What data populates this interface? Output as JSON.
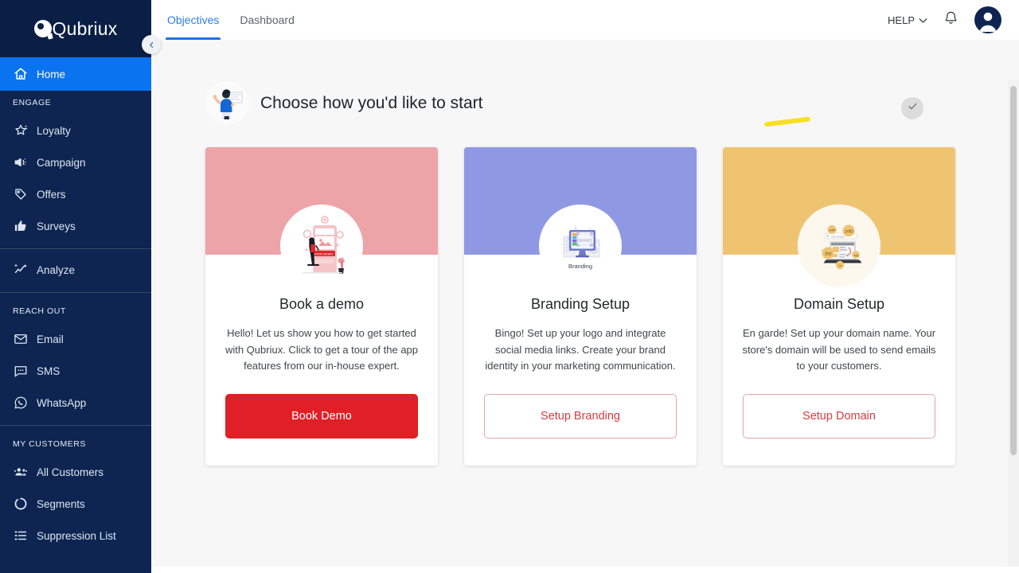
{
  "brand": {
    "name": "Qubriux"
  },
  "sidebar": {
    "collapse_icon": "chevron-left-icon",
    "home": {
      "label": "Home",
      "icon": "home-icon"
    },
    "groups": [
      {
        "label": "ENGAGE",
        "items": [
          {
            "label": "Loyalty",
            "icon": "star-badge-icon"
          },
          {
            "label": "Campaign",
            "icon": "megaphone-icon"
          },
          {
            "label": "Offers",
            "icon": "tag-icon"
          },
          {
            "label": "Surveys",
            "icon": "thumbs-up-icon"
          },
          {
            "label": "Analyze",
            "icon": "analytics-icon"
          }
        ]
      },
      {
        "label": "REACH OUT",
        "items": [
          {
            "label": "Email",
            "icon": "envelope-icon"
          },
          {
            "label": "SMS",
            "icon": "chat-bubble-icon"
          },
          {
            "label": "WhatsApp",
            "icon": "whatsapp-icon"
          }
        ]
      },
      {
        "label": "MY CUSTOMERS",
        "items": [
          {
            "label": "All Customers",
            "icon": "people-icon"
          },
          {
            "label": "Segments",
            "icon": "segments-circle-icon"
          },
          {
            "label": "Suppression List",
            "icon": "list-icon"
          }
        ]
      }
    ]
  },
  "topbar": {
    "tabs": [
      {
        "label": "Objectives",
        "active": true
      },
      {
        "label": "Dashboard",
        "active": false
      }
    ],
    "help_label": "HELP",
    "help_chevron_icon": "chevron-down-icon",
    "notification_icon": "bell-icon",
    "avatar_icon": "user-avatar-icon"
  },
  "main": {
    "heading": "Choose how you'd like to start",
    "heading_icon": "presenter-person-illustration",
    "marker_annotation": "yellow-highlight-stroke",
    "step_check_icon": "check-circle-icon",
    "cards": [
      {
        "title": "Book a demo",
        "description": "Hello! Let us show you how to get started with Qubriux. Click to get a tour of the app features from our in-house expert.",
        "button_label": "Book Demo",
        "button_style": "filled",
        "header_color": "#EDA4A8",
        "illustration": "person-mobile-booking-illustration"
      },
      {
        "title": "Branding Setup",
        "description": "Bingo! Set up your logo and integrate social media links. Create your brand identity in your marketing communication.",
        "button_label": "Setup Branding",
        "button_style": "outline",
        "header_color": "#8F99E3",
        "illustration": "monitor-branding-illustration",
        "illustration_caption": "Branding"
      },
      {
        "title": "Domain Setup",
        "description": "En garde! Set up your domain name. Your store's domain will be used to send emails to your customers.",
        "button_label": "Setup Domain",
        "button_style": "outline",
        "header_color": "#EFC471",
        "illustration": "laptop-domain-illustration",
        "domain_bubbles": [
          ".com",
          ".info",
          ".biz",
          ".org"
        ]
      }
    ]
  },
  "colors": {
    "sidebar_bg": "#0D2550",
    "sidebar_brand_bg": "#0A1F45",
    "active_nav": "#0A73F0",
    "accent_red": "#E01F26",
    "tab_active": "#1A73E8",
    "canvas": "#F7F7F8"
  }
}
